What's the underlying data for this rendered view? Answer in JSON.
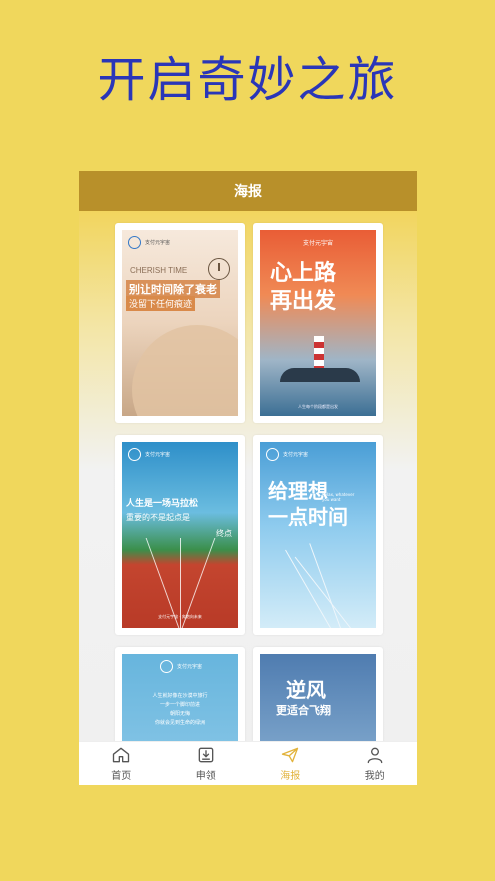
{
  "headline": "开启奇妙之旅",
  "app": {
    "title": "海报",
    "colors": {
      "accent": "#e2b33c",
      "topbar": "#b8902a",
      "background": "#f0d75c",
      "headline": "#2a36b8"
    }
  },
  "posters": [
    {
      "icon": "clock-icon",
      "logo_text": "支付元宇宙",
      "en": "CHERISH TIME",
      "title": "别让时间除了衰老",
      "subtitle": "没留下任何痕迹"
    },
    {
      "badge": "支付元宇宙",
      "title_line1": "心上路",
      "title_line2": "再出发",
      "footer": "人生每个阶段都是出发"
    },
    {
      "logo_text": "支付元宇宙",
      "line1": "人生是一场马拉松",
      "line2": "重要的不是起点是",
      "line3": "终点",
      "footer": "支付元宇宙 · 奔跑向未来"
    },
    {
      "logo_text": "支付元宇宙",
      "title_line1": "给理想",
      "title_line2": "一点时间",
      "en": "Relax, whatever you want"
    },
    {
      "logo_text": "支付元宇宙",
      "lines": [
        "人生就好像在沙漠中旅行",
        "一步一个脚印前进",
        "朝阳无悔",
        "你就会见到生命的绿洲"
      ]
    },
    {
      "title": "逆风",
      "subtitle": "更适合飞翔"
    }
  ],
  "tabs": [
    {
      "label": "首页",
      "icon": "home-icon",
      "active": false
    },
    {
      "label": "申领",
      "icon": "download-box-icon",
      "active": false
    },
    {
      "label": "海报",
      "icon": "paper-plane-icon",
      "active": true
    },
    {
      "label": "我的",
      "icon": "user-icon",
      "active": false
    }
  ]
}
